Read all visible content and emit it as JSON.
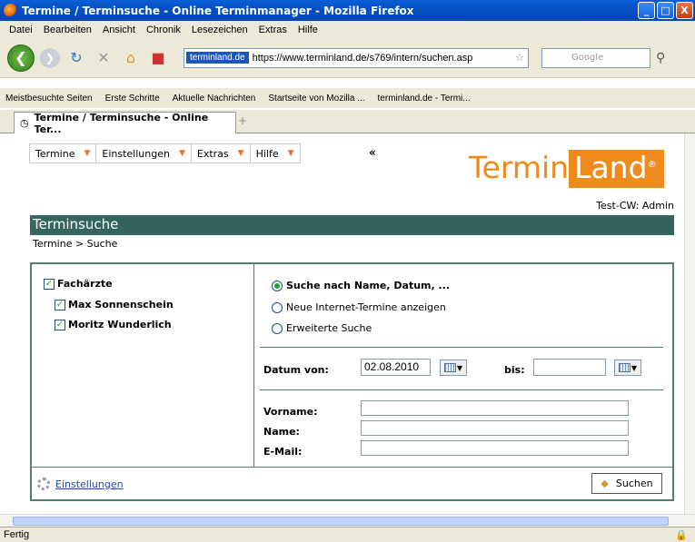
{
  "window": {
    "title": "Termine / Terminsuche - Online Terminmanager - Mozilla Firefox",
    "buttons": {
      "minimize": "_",
      "maximize": "□",
      "close": "X"
    }
  },
  "menubar": [
    "Datei",
    "Bearbeiten",
    "Ansicht",
    "Chronik",
    "Lesezeichen",
    "Extras",
    "Hilfe"
  ],
  "navbar": {
    "site_identity": "terminland.de",
    "url": "https://www.terminland.de/s769/intern/suchen.asp",
    "search_placeholder": "Google"
  },
  "bookmarks": [
    "Meistbesuchte Seiten",
    "Erste Schritte",
    "Aktuelle Nachrichten",
    "Startseite von Mozilla ...",
    "terminland.de - Termi..."
  ],
  "tab": {
    "label": "Termine / Terminsuche - Online Ter...",
    "new_tab": "+"
  },
  "app": {
    "menu": [
      "Termine",
      "Einstellungen",
      "Extras",
      "Hilfe"
    ],
    "collapse": "«",
    "logo": {
      "part1": "Termin",
      "part2": "Land",
      "reg": "®"
    },
    "user": "Test-CW: Admin",
    "section_title": "Terminsuche",
    "breadcrumb": "Termine > Suche",
    "tree": {
      "group": "Fachärzte",
      "items": [
        "Max Sonnenschein",
        "Moritz Wunderlich"
      ]
    },
    "search_modes": [
      "Suche nach Name, Datum, ...",
      "Neue Internet-Termine anzeigen",
      "Erweiterte Suche"
    ],
    "selected_mode": 0,
    "date": {
      "from_label": "Datum von:",
      "from_value": "02.08.2010",
      "to_label": "bis:",
      "to_value": ""
    },
    "fields": {
      "vorname_label": "Vorname:",
      "name_label": "Name:",
      "email_label": "E-Mail:"
    },
    "settings_link": "Einstellungen",
    "search_button": "Suchen"
  },
  "status": "Fertig"
}
